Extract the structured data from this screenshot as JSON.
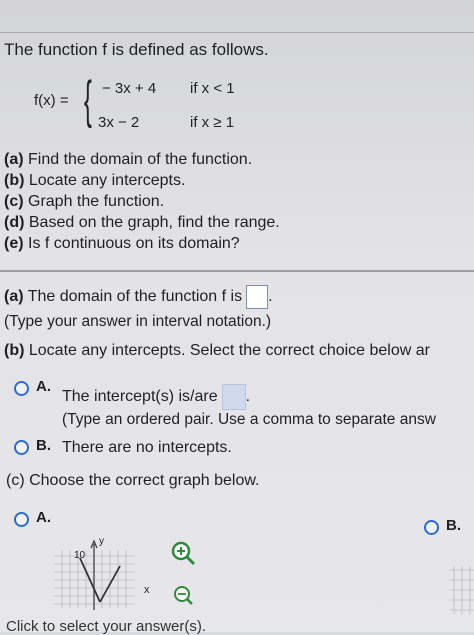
{
  "problem": {
    "title": "The function f is defined as follows.",
    "fx_label": "f(x) =",
    "cases": [
      {
        "expr": "− 3x + 4",
        "cond": "if x < 1"
      },
      {
        "expr": "3x − 2",
        "cond": "if x ≥ 1"
      }
    ],
    "parts": [
      {
        "letter": "(a)",
        "text": " Find the domain of the function."
      },
      {
        "letter": "(b)",
        "text": " Locate any intercepts."
      },
      {
        "letter": "(c)",
        "text": " Graph the function."
      },
      {
        "letter": "(d)",
        "text": " Based on the graph, find the range."
      },
      {
        "letter": "(e)",
        "text": " Is f continuous on its domain?"
      }
    ]
  },
  "answers": {
    "a": {
      "letter": "(a)",
      "prompt": " The domain of the function f is",
      "period": ".",
      "note": "(Type your answer in interval notation.)"
    },
    "b": {
      "letter": "(b)",
      "prompt": " Locate any intercepts. Select the correct choice below ar",
      "option_a_label": "A.",
      "option_a_text": "The intercept(s) is/are",
      "option_a_period": ".",
      "option_a_note": "(Type an ordered pair. Use a comma to separate answ",
      "option_b_label": "B.",
      "option_b_text": "There are no intercepts."
    },
    "c": {
      "prompt": "(c) Choose the correct graph below.",
      "graph_a_label": "A.",
      "graph_b_label": "B.",
      "graph_y_label": "y",
      "graph_tick": "10",
      "graph_x_label": "x"
    }
  },
  "footer": {
    "text": "Click to select your answer(s)."
  },
  "colors": {
    "radio": "#2e6ad1",
    "answer_box_border": "#7d8fb8",
    "magnifier": "#2e8a3a"
  }
}
